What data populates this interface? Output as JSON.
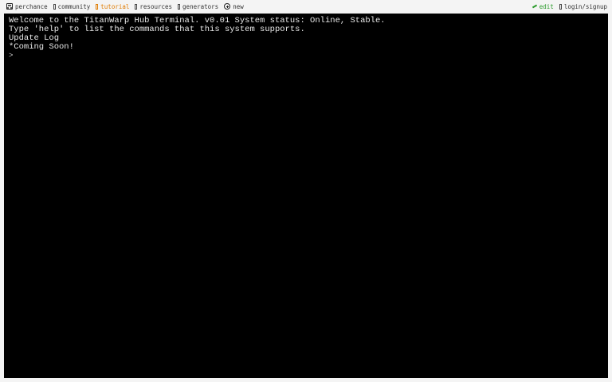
{
  "nav": {
    "brand": "perchance",
    "items": [
      {
        "label": "community",
        "icon": "book-icon"
      },
      {
        "label": "tutorial",
        "icon": "book-icon"
      },
      {
        "label": "resources",
        "icon": "book-icon"
      },
      {
        "label": "generators",
        "icon": "book-icon"
      },
      {
        "label": "new",
        "icon": "plus-icon"
      }
    ],
    "edit_label": "edit",
    "login_label": "login/signup"
  },
  "colors": {
    "accent_tutorial": "#e07b00",
    "accent_edit": "#2a9a2a",
    "terminal_bg": "#000000",
    "terminal_text": "#e8e8e8"
  },
  "terminal": {
    "lines": [
      "Welcome to the TitanWarp Hub Terminal. v0.01 System status: Online, Stable.",
      "Type 'help' to list the commands that this system supports.",
      "Update Log",
      "*Coming Soon!"
    ],
    "prompt": ">"
  }
}
